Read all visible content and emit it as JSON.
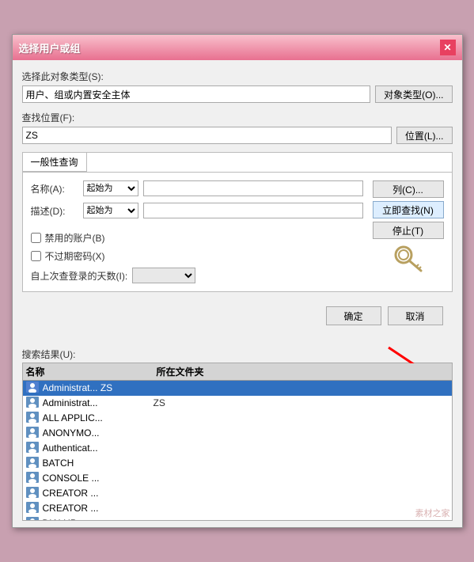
{
  "dialog": {
    "title": "选择用户或组",
    "close_label": "✕"
  },
  "object_type": {
    "label": "选择此对象类型(S):",
    "value": "用户、组或内置安全主体",
    "button": "对象类型(O)..."
  },
  "location": {
    "label": "查找位置(F):",
    "value": "ZS",
    "button": "位置(L)..."
  },
  "section_tab": "一般性查询",
  "form": {
    "name_label": "名称(A):",
    "name_select": "起始为",
    "desc_label": "描述(D):",
    "desc_select": "起始为",
    "checkbox1": "禁用的账户(B)",
    "checkbox2": "不过期密码(X)",
    "days_label": "自上次查登录的天数(I):",
    "col_button": "列(C)...",
    "search_button": "立即查找(N)",
    "stop_button": "停止(T)"
  },
  "bottom_buttons": {
    "confirm": "确定",
    "cancel": "取消"
  },
  "results": {
    "label": "搜索结果(U):",
    "header_name": "名称",
    "header_folder": "所在文件夹",
    "scroll_up": "▲",
    "scroll_down": "▼",
    "items": [
      {
        "name": "Administrat... ZS",
        "folder": "",
        "selected": true,
        "icon": "user"
      },
      {
        "name": "Administrat...",
        "folder": "ZS",
        "selected": false,
        "icon": "user"
      },
      {
        "name": "ALL APPLIC...",
        "folder": "",
        "selected": false,
        "icon": "user"
      },
      {
        "name": "ANONYMO...",
        "folder": "",
        "selected": false,
        "icon": "user"
      },
      {
        "name": "Authenticat...",
        "folder": "",
        "selected": false,
        "icon": "user"
      },
      {
        "name": "BATCH",
        "folder": "",
        "selected": false,
        "icon": "user"
      },
      {
        "name": "CONSOLE ...",
        "folder": "",
        "selected": false,
        "icon": "user"
      },
      {
        "name": "CREATOR ...",
        "folder": "",
        "selected": false,
        "icon": "user"
      },
      {
        "name": "CREATOR ...",
        "folder": "",
        "selected": false,
        "icon": "user"
      },
      {
        "name": "DIALUP",
        "folder": "",
        "selected": false,
        "icon": "user"
      }
    ]
  }
}
